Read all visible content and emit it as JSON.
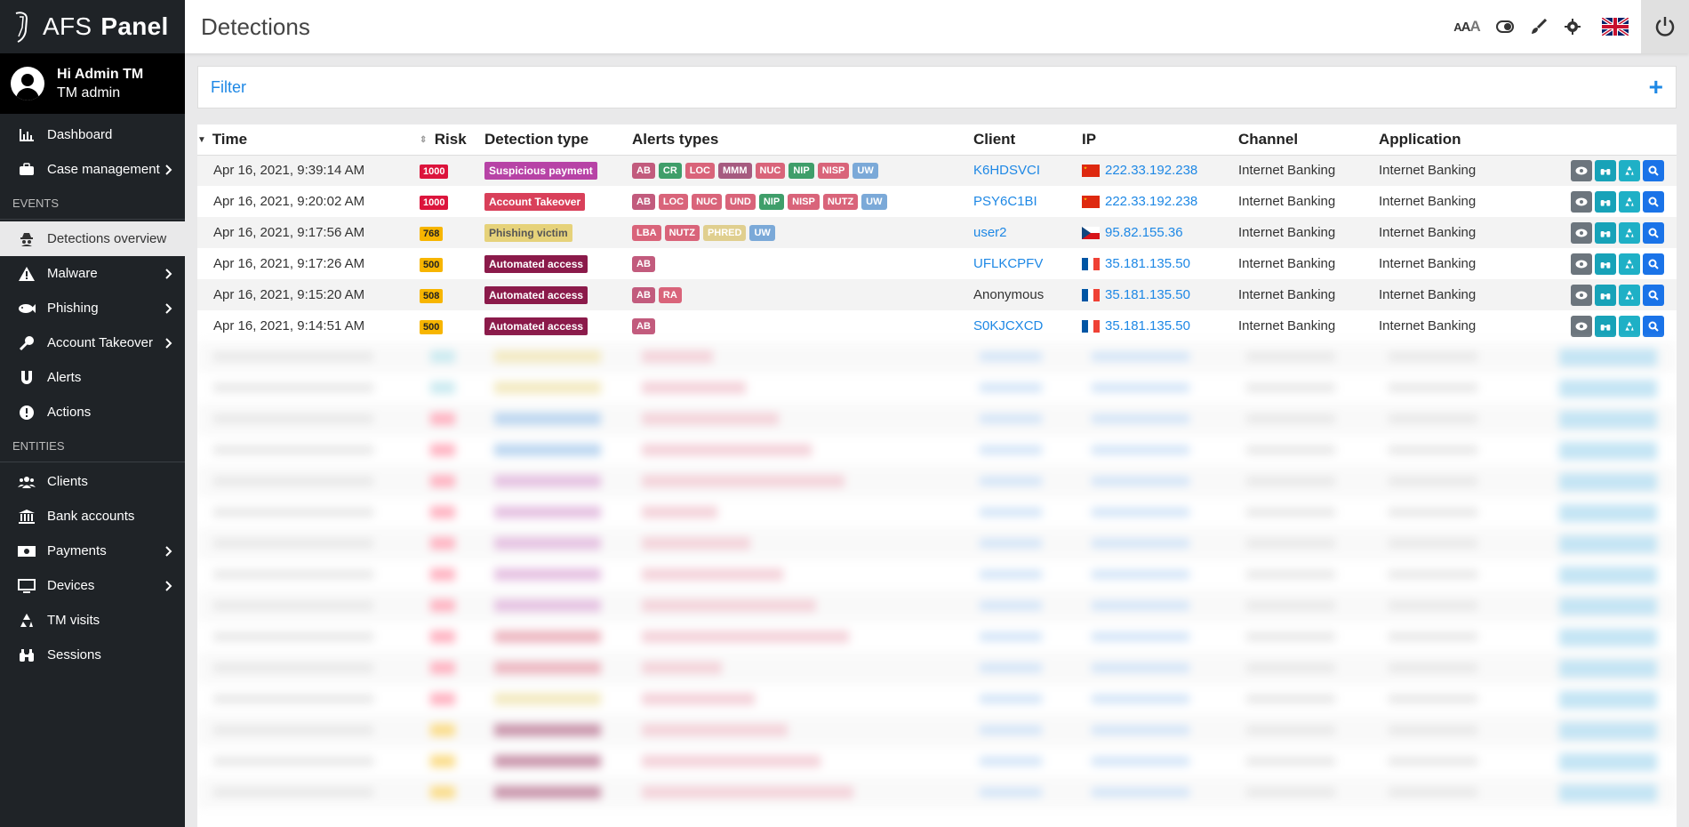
{
  "app": {
    "title_light": "AFS",
    "title_bold": "Panel"
  },
  "user": {
    "greeting": "Hi Admin TM",
    "role": "TM admin"
  },
  "sidebar": {
    "top_items": [
      {
        "label": "Dashboard",
        "icon": "chart-icon"
      },
      {
        "label": "Case management",
        "icon": "briefcase-icon"
      }
    ],
    "events_title": "EVENTS",
    "events_items": [
      {
        "label": "Detections overview",
        "icon": "spy-icon"
      },
      {
        "label": "Malware",
        "icon": "warning-icon"
      },
      {
        "label": "Phishing",
        "icon": "fish-icon"
      },
      {
        "label": "Account Takeover",
        "icon": "key-icon"
      },
      {
        "label": "Alerts",
        "icon": "magnet-icon"
      },
      {
        "label": "Actions",
        "icon": "exclamation-icon"
      }
    ],
    "entities_title": "ENTITIES",
    "entities_items": [
      {
        "label": "Clients",
        "icon": "users-icon"
      },
      {
        "label": "Bank accounts",
        "icon": "bank-icon"
      },
      {
        "label": "Payments",
        "icon": "money-icon"
      },
      {
        "label": "Devices",
        "icon": "monitor-icon"
      },
      {
        "label": "TM visits",
        "icon": "recycle-icon"
      },
      {
        "label": "Sessions",
        "icon": "binoculars-icon"
      }
    ]
  },
  "header": {
    "page_title": "Detections",
    "font_size_label": "AAA"
  },
  "filter": {
    "label": "Filter",
    "add": "+"
  },
  "table": {
    "columns": [
      "Time",
      "Risk",
      "Detection type",
      "Alerts types",
      "Client",
      "IP",
      "Channel",
      "Application"
    ],
    "rows": [
      {
        "time": "Apr 16, 2021, 9:39:14 AM",
        "risk": "1000",
        "risk_color": "#dc143c",
        "dtype": "Suspicious payment",
        "dtype_color": "#b743a6",
        "alerts": [
          [
            "AB",
            "#c25b7d"
          ],
          [
            "CR",
            "#3f9e6a"
          ],
          [
            "LOC",
            "#d9647a"
          ],
          [
            "MMM",
            "#a65b80"
          ],
          [
            "NUC",
            "#d9647a"
          ],
          [
            "NIP",
            "#3f9e6a"
          ],
          [
            "NISP",
            "#d9647a"
          ],
          [
            "UW",
            "#7ba9d8"
          ]
        ],
        "client": "K6HDSVCI",
        "flag": "cn",
        "ip": "222.33.192.238",
        "channel": "Internet Banking",
        "application": "Internet Banking"
      },
      {
        "time": "Apr 16, 2021, 9:20:02 AM",
        "risk": "1000",
        "risk_color": "#dc143c",
        "dtype": "Account Takeover",
        "dtype_color": "#d9405a",
        "alerts": [
          [
            "AB",
            "#c25b7d"
          ],
          [
            "LOC",
            "#d9647a"
          ],
          [
            "NUC",
            "#d9647a"
          ],
          [
            "UND",
            "#d9647a"
          ],
          [
            "NIP",
            "#3f9e6a"
          ],
          [
            "NISP",
            "#d9647a"
          ],
          [
            "NUTZ",
            "#d9647a"
          ],
          [
            "UW",
            "#7ba9d8"
          ]
        ],
        "client": "PSY6C1BI",
        "flag": "cn",
        "ip": "222.33.192.238",
        "channel": "Internet Banking",
        "application": "Internet Banking"
      },
      {
        "time": "Apr 16, 2021, 9:17:56 AM",
        "risk": "768",
        "risk_color": "#f7b500",
        "dtype": "Phishing victim",
        "dtype_color": "#e6d27a",
        "alerts": [
          [
            "LBA",
            "#d9647a"
          ],
          [
            "NUTZ",
            "#d9647a"
          ],
          [
            "PHRED",
            "#e0cf8f"
          ],
          [
            "UW",
            "#7ba9d8"
          ]
        ],
        "client": "user2",
        "flag": "cz",
        "ip": "95.82.155.36",
        "channel": "Internet Banking",
        "application": "Internet Banking"
      },
      {
        "time": "Apr 16, 2021, 9:17:26 AM",
        "risk": "500",
        "risk_color": "#f7b500",
        "dtype": "Automated access",
        "dtype_color": "#8b1a4a",
        "alerts": [
          [
            "AB",
            "#c25b7d"
          ]
        ],
        "client": "UFLKCPFV",
        "flag": "fr",
        "ip": "35.181.135.50",
        "channel": "Internet Banking",
        "application": "Internet Banking"
      },
      {
        "time": "Apr 16, 2021, 9:15:20 AM",
        "risk": "508",
        "risk_color": "#f7b500",
        "dtype": "Automated access",
        "dtype_color": "#8b1a4a",
        "alerts": [
          [
            "AB",
            "#c25b7d"
          ],
          [
            "RA",
            "#d9647a"
          ]
        ],
        "client": "Anonymous",
        "flag": "fr",
        "ip": "35.181.135.50",
        "channel": "Internet Banking",
        "application": "Internet Banking"
      },
      {
        "time": "Apr 16, 2021, 9:14:51 AM",
        "risk": "500",
        "risk_color": "#f7b500",
        "dtype": "Automated access",
        "dtype_color": "#8b1a4a",
        "alerts": [
          [
            "AB",
            "#c25b7d"
          ]
        ],
        "client": "S0KJCXCD",
        "flag": "fr",
        "ip": "35.181.135.50",
        "channel": "Internet Banking",
        "application": "Internet Banking"
      }
    ]
  }
}
